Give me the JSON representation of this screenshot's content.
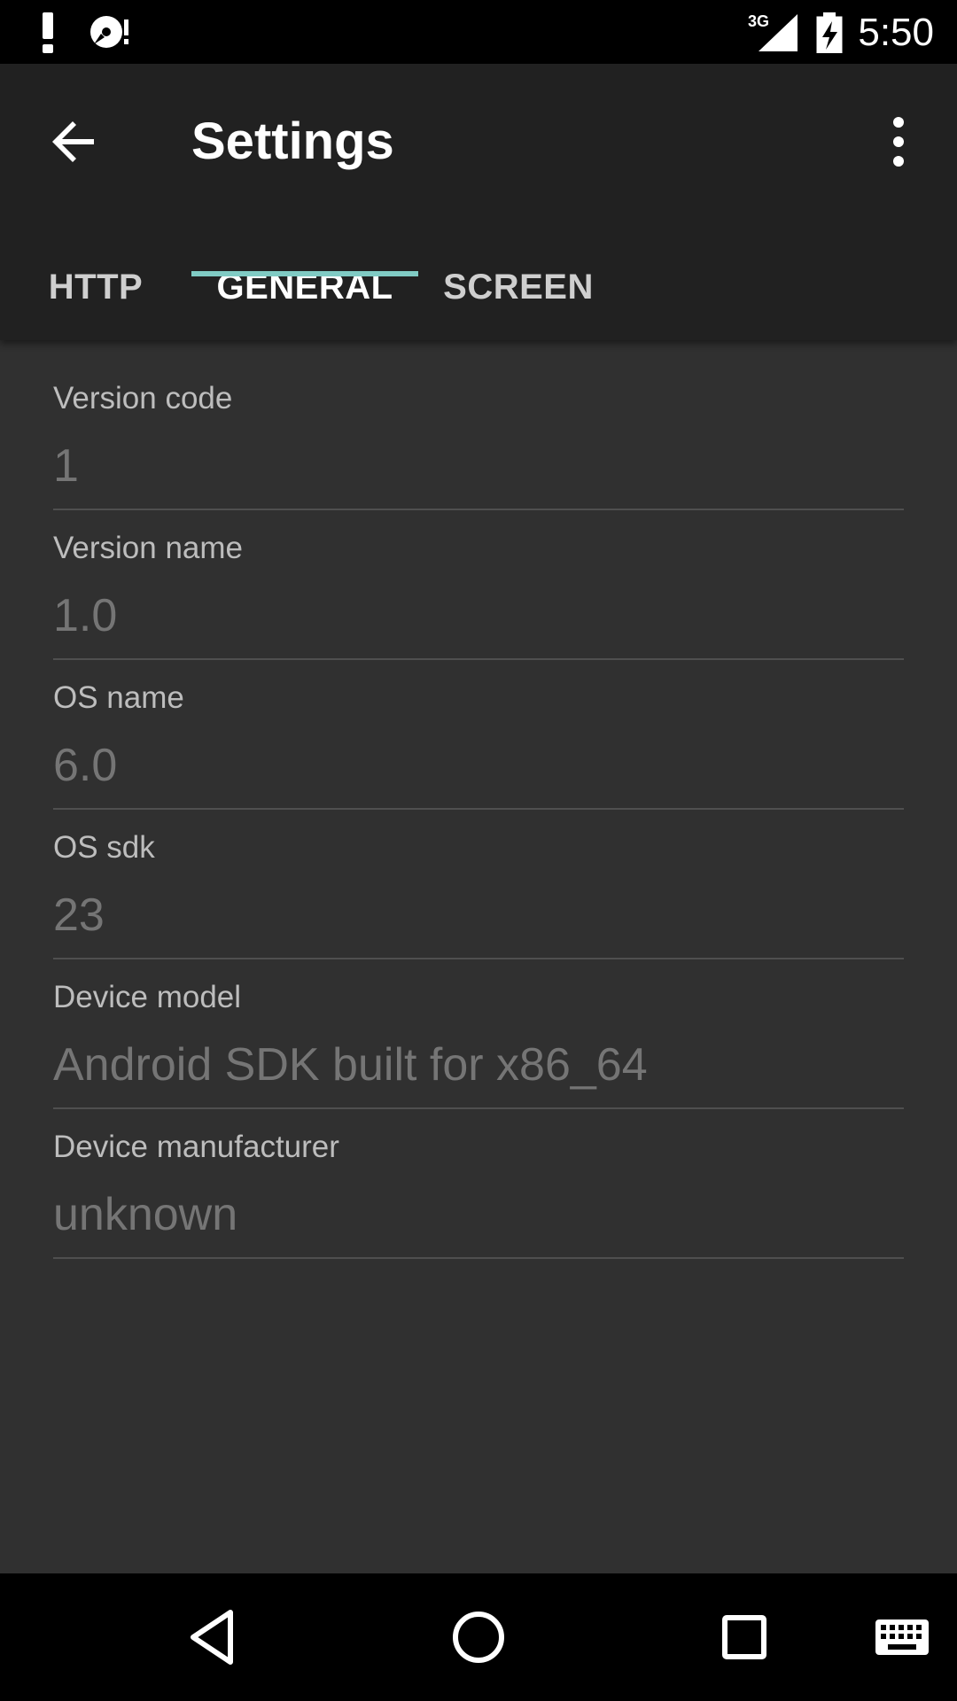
{
  "status_bar": {
    "time": "5:50",
    "network": "3G",
    "icons": [
      "warning-icon",
      "disc-icon",
      "signal-3g-icon",
      "battery-charging-icon"
    ]
  },
  "app_bar": {
    "title": "Settings",
    "back_icon": "arrow-back-icon",
    "overflow_icon": "more-vert-icon"
  },
  "tabs": [
    {
      "label": "HTTP",
      "active": false
    },
    {
      "label": "GENERAL",
      "active": true
    },
    {
      "label": "SCREEN",
      "active": false
    }
  ],
  "colors": {
    "accent": "#80cbc4",
    "app_bar": "#212121",
    "background": "#303030"
  },
  "fields": [
    {
      "label": "Version code",
      "value": "1"
    },
    {
      "label": "Version name",
      "value": "1.0"
    },
    {
      "label": "OS name",
      "value": "6.0"
    },
    {
      "label": "OS sdk",
      "value": "23"
    },
    {
      "label": "Device model",
      "value": "Android SDK built for x86_64"
    },
    {
      "label": "Device manufacturer",
      "value": "unknown"
    }
  ],
  "nav_bar": {
    "icons": [
      "nav-back-icon",
      "nav-home-icon",
      "nav-recents-icon",
      "keyboard-icon"
    ]
  }
}
